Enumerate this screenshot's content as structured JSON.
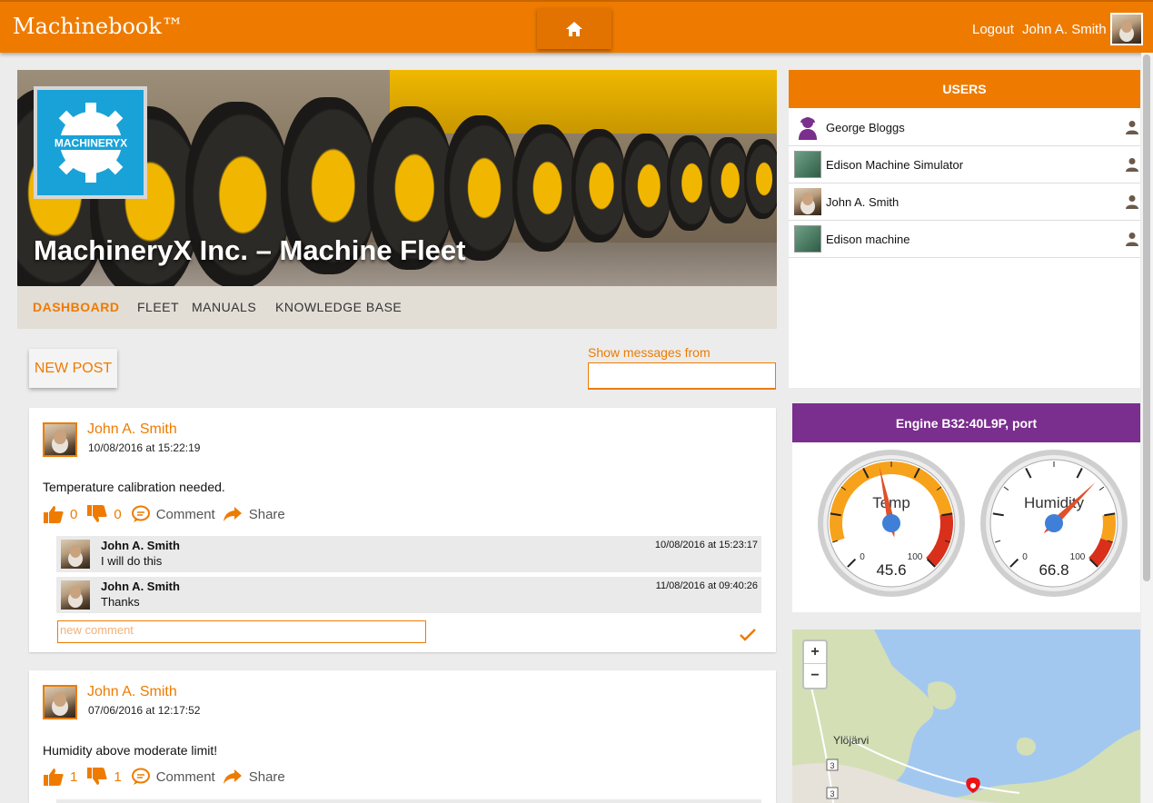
{
  "header": {
    "brand": "Machinebook™",
    "logout": "Logout",
    "user_name": "John A. Smith"
  },
  "hero": {
    "title": "MachineryX Inc. – Machine Fleet",
    "logo_text": "MACHINERYX"
  },
  "nav": {
    "items": [
      "DASHBOARD",
      "FLEET",
      "MANUALS",
      "KNOWLEDGE BASE"
    ],
    "active": "DASHBOARD"
  },
  "toolbar": {
    "new_post": "NEW POST",
    "show_messages_label": "Show messages from",
    "show_messages_value": ""
  },
  "posts": [
    {
      "author": "John A. Smith",
      "date": "10/08/2016 at 15:22:19",
      "text": "Temperature calibration needed.",
      "likes": "0",
      "dislikes": "0",
      "comment_label": "Comment",
      "share_label": "Share",
      "comments": [
        {
          "author": "John A. Smith",
          "text": "I will do this",
          "date": "10/08/2016 at 15:23:17"
        },
        {
          "author": "John A. Smith",
          "text": "Thanks",
          "date": "11/08/2016 at 09:40:26"
        }
      ],
      "new_comment_placeholder": "new comment"
    },
    {
      "author": "John A. Smith",
      "date": "07/06/2016 at 12:17:52",
      "text": "Humidity above moderate limit!",
      "likes": "1",
      "dislikes": "1",
      "comment_label": "Comment",
      "share_label": "Share"
    }
  ],
  "users": {
    "title": "USERS",
    "list": [
      "George Bloggs",
      "Edison Machine Simulator",
      "John A. Smith",
      "Edison machine"
    ]
  },
  "engine": {
    "title": "Engine B32:40L9P, port",
    "gauges": [
      {
        "label": "Temp",
        "value": "45.6",
        "min": "0",
        "max": "100",
        "numeric": 45.6
      },
      {
        "label": "Humidity",
        "value": "66.8",
        "min": "0",
        "max": "100",
        "numeric": 66.8
      }
    ]
  },
  "map": {
    "zoom_in": "+",
    "zoom_out": "−",
    "place": "Ylöjärvi",
    "road_1": "3",
    "road_2": "3"
  },
  "colors": {
    "primary": "#ee7b00",
    "purple": "#7a2e8e",
    "brand_blue": "#19a2d8"
  }
}
